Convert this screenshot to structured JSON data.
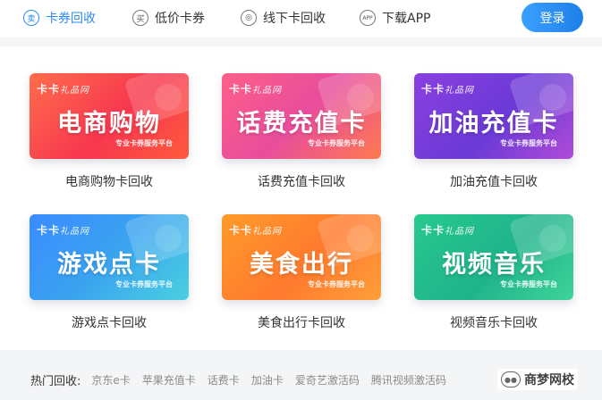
{
  "nav": {
    "items": [
      {
        "label": "卡券回收",
        "icon": "sell-icon",
        "glyph": "卖",
        "active": true
      },
      {
        "label": "低价卡券",
        "icon": "buy-icon",
        "glyph": "买",
        "active": false
      },
      {
        "label": "线下卡回收",
        "icon": "globe-icon",
        "glyph": "◎",
        "active": false
      },
      {
        "label": "下载APP",
        "icon": "app-icon",
        "glyph": "APP",
        "active": false
      }
    ],
    "login_label": "登录"
  },
  "brand": {
    "name": "卡卡",
    "sub": "礼品网"
  },
  "cards": [
    {
      "title": "电商购物",
      "label": "电商购物卡回收",
      "slogan": "专业卡券服务平台",
      "color": "#f7374f"
    },
    {
      "title": "话费充值卡",
      "label": "话费充值卡回收",
      "slogan": "专业卡券服务平台",
      "color": "#e84d9c"
    },
    {
      "title": "加油充值卡",
      "label": "加油充值卡回收",
      "slogan": "专业卡券服务平台",
      "color": "#6b3ad6"
    },
    {
      "title": "游戏点卡",
      "label": "游戏点卡回收",
      "slogan": "专业卡券服务平台",
      "color": "#3aa3f0"
    },
    {
      "title": "美食出行",
      "label": "美食出行卡回收",
      "slogan": "专业卡券服务平台",
      "color": "#ff7a2e"
    },
    {
      "title": "视频音乐",
      "label": "视频音乐卡回收",
      "slogan": "专业卡券服务平台",
      "color": "#1fb38b"
    }
  ],
  "hot": {
    "title": "热门回收:",
    "links": [
      "京东e卡",
      "苹果充值卡",
      "话费卡",
      "加油卡",
      "爱奇艺激活码",
      "腾讯视频激活码"
    ]
  },
  "watermark": {
    "text": "商梦网校"
  },
  "colors": {
    "accent": "#2d8cf0"
  }
}
